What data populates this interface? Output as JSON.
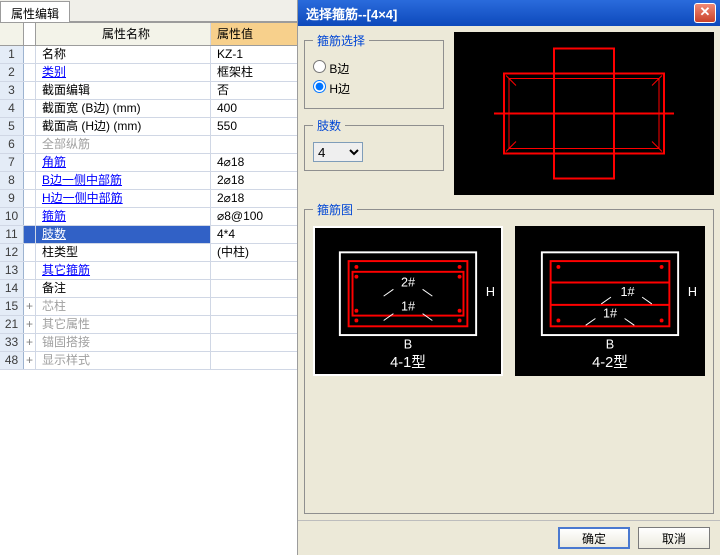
{
  "left": {
    "tab": "属性编辑",
    "columns": {
      "name": "属性名称",
      "value": "属性值"
    },
    "rows": [
      {
        "n": "1",
        "name": "名称",
        "val": "KZ-1"
      },
      {
        "n": "2",
        "name": "类别",
        "val": "框架柱",
        "link": true
      },
      {
        "n": "3",
        "name": "截面编辑",
        "val": "否"
      },
      {
        "n": "4",
        "name": "截面宽 (B边) (mm)",
        "val": "400"
      },
      {
        "n": "5",
        "name": "截面高 (H边) (mm)",
        "val": "550"
      },
      {
        "n": "6",
        "name": "全部纵筋",
        "val": "",
        "dim": true
      },
      {
        "n": "7",
        "name": "角筋",
        "val": "4⌀18",
        "link": true
      },
      {
        "n": "8",
        "name": "B边一侧中部筋",
        "val": "2⌀18",
        "link": true
      },
      {
        "n": "9",
        "name": "H边一侧中部筋",
        "val": "2⌀18",
        "link": true
      },
      {
        "n": "10",
        "name": "箍筋",
        "val": "⌀8@100",
        "link": true
      },
      {
        "n": "11",
        "name": "肢数",
        "val": "4*4",
        "link": true,
        "sel": true
      },
      {
        "n": "12",
        "name": "柱类型",
        "val": "(中柱)"
      },
      {
        "n": "13",
        "name": "其它箍筋",
        "val": "",
        "link": true
      },
      {
        "n": "14",
        "name": "备注",
        "val": ""
      },
      {
        "n": "15",
        "name": "芯柱",
        "val": "",
        "exp": "+",
        "dim": true
      },
      {
        "n": "21",
        "name": "其它属性",
        "val": "",
        "exp": "+",
        "dim": true
      },
      {
        "n": "33",
        "name": "锚固搭接",
        "val": "",
        "exp": "+",
        "dim": true
      },
      {
        "n": "48",
        "name": "显示样式",
        "val": "",
        "exp": "+",
        "dim": true
      }
    ]
  },
  "dialog": {
    "title": "选择箍筋--[4×4]",
    "legend_select": "箍筋选择",
    "radio_b": "B边",
    "radio_h": "H边",
    "radio_checked": "H边",
    "legend_limb": "肢数",
    "limb_value": "4",
    "legend_thumbs": "箍筋图",
    "thumbs": [
      {
        "label": "4-1型",
        "b": "B",
        "h": "H",
        "t1": "2#",
        "t2": "1#",
        "selected": true
      },
      {
        "label": "4-2型",
        "b": "B",
        "h": "H",
        "t1": "1#",
        "t2": "1#",
        "selected": false
      }
    ],
    "ok": "确定",
    "cancel": "取消"
  }
}
